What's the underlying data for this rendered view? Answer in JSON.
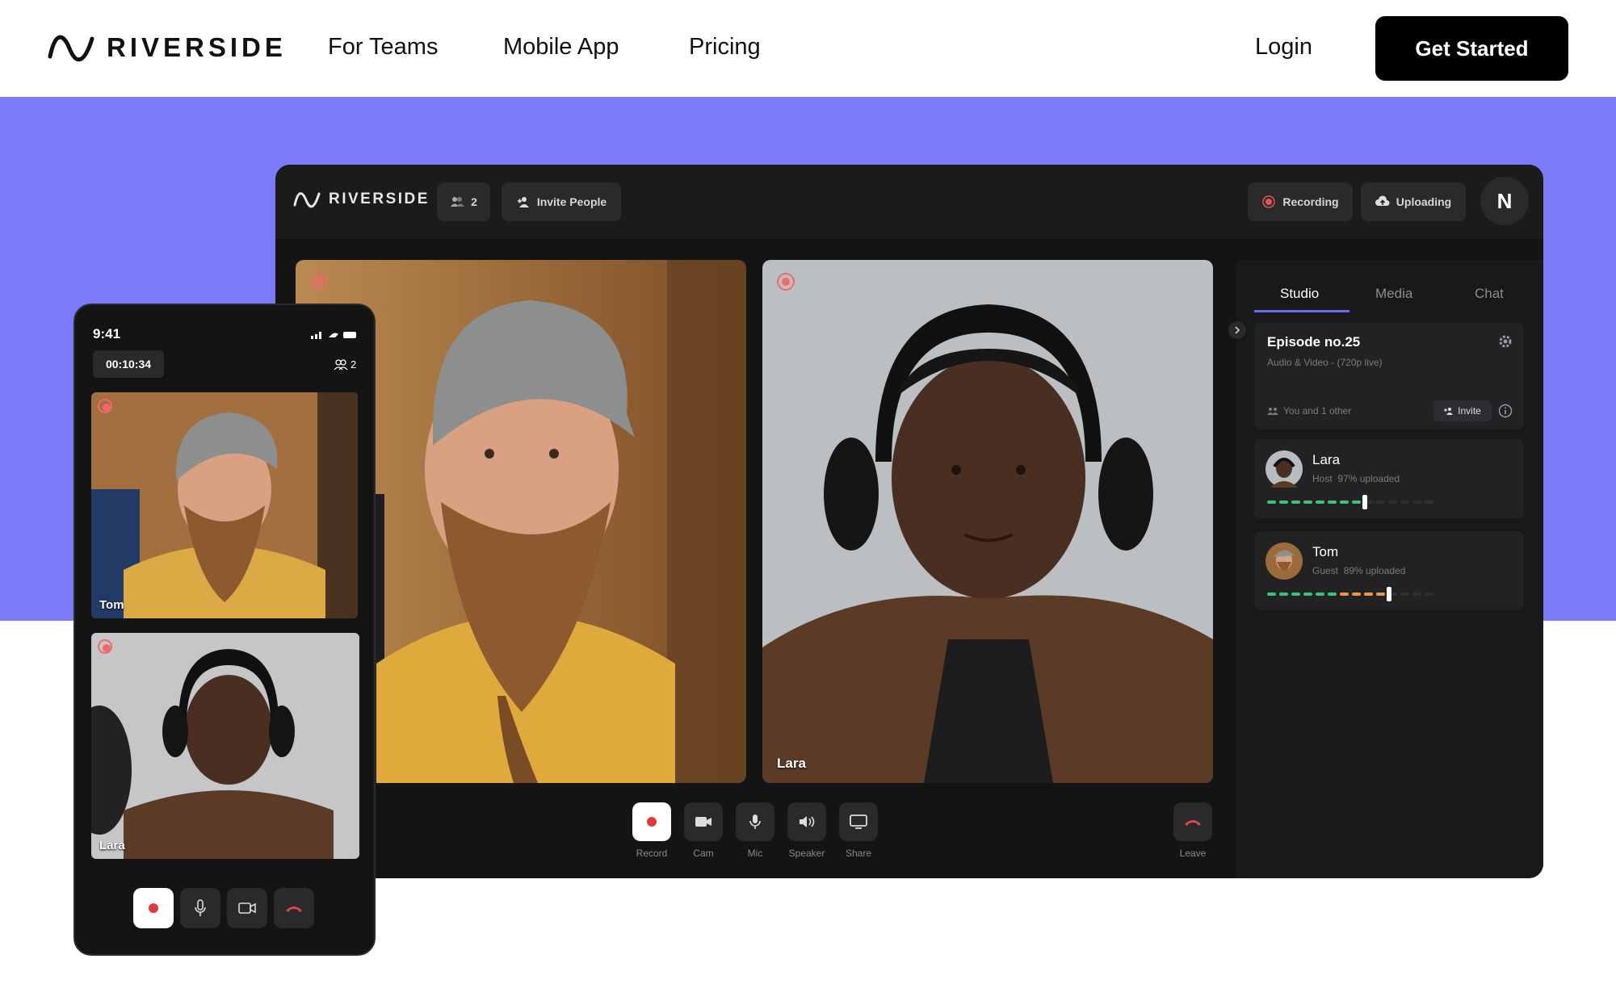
{
  "nav": {
    "brand": "RIVERSIDE",
    "links": [
      "For Teams",
      "Mobile App",
      "Pricing"
    ],
    "login": "Login",
    "cta": "Get Started"
  },
  "colors": {
    "band": "#7b7af9",
    "accent": "#6b6bf0",
    "record": "#f06a6a",
    "green": "#3ec07a",
    "orange": "#f0963e"
  },
  "studio": {
    "brand": "RIVERSIDE",
    "participants_count": "2",
    "invite_people": "Invite People",
    "recording": "Recording",
    "uploading": "Uploading",
    "user_initial": "N",
    "tiles": [
      {
        "name": ""
      },
      {
        "name": "Lara"
      }
    ],
    "controls": [
      "Record",
      "Cam",
      "Mic",
      "Speaker",
      "Share"
    ],
    "leave": "Leave",
    "tabs": [
      "Studio",
      "Media",
      "Chat"
    ],
    "episode": {
      "title": "Episode no.25",
      "subtitle": "Audio & Video - (720p live)",
      "people": "You and 1 other",
      "invite": "Invite"
    },
    "uploads": [
      {
        "name": "Lara",
        "role": "Host",
        "status": "97% uploaded",
        "progress": 0.97
      },
      {
        "name": "Tom",
        "role": "Guest",
        "status": "89% uploaded",
        "progress": 0.89
      }
    ]
  },
  "phone": {
    "time": "9:41",
    "timer": "00:10:34",
    "participants": "2",
    "tiles": [
      {
        "name": "Tom"
      },
      {
        "name": "Lara"
      }
    ]
  }
}
